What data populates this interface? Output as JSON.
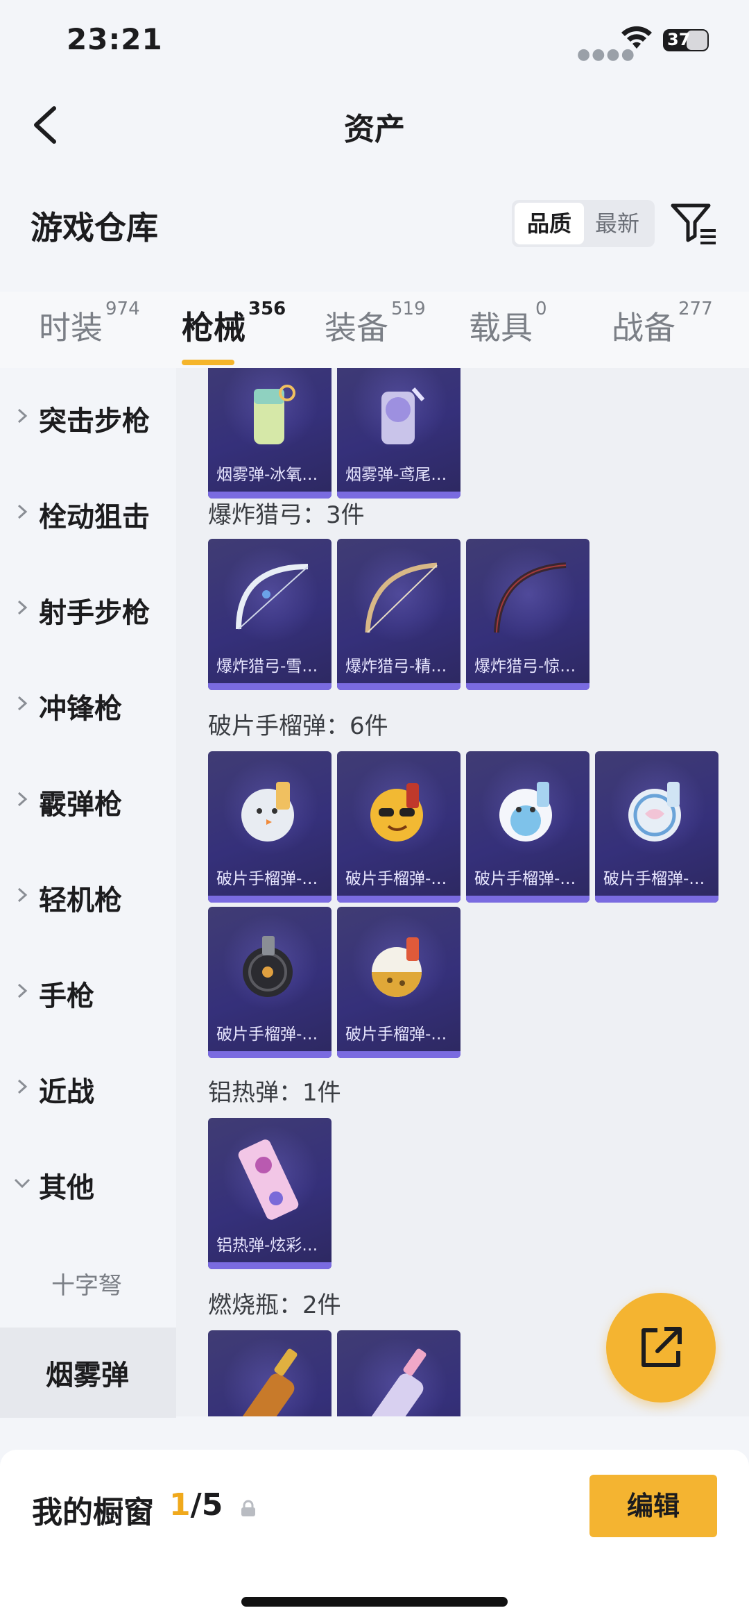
{
  "status": {
    "time": "23:21",
    "battery": "37"
  },
  "nav": {
    "title": "资产"
  },
  "warehouse": {
    "label": "游戏仓库",
    "sort_options": [
      "品质",
      "最新"
    ],
    "sort_selected": "品质"
  },
  "tabs": [
    {
      "label": "时装",
      "count": "974"
    },
    {
      "label": "枪械",
      "count": "356",
      "active": true
    },
    {
      "label": "装备",
      "count": "519"
    },
    {
      "label": "载具",
      "count": "0"
    },
    {
      "label": "战备",
      "count": "277"
    }
  ],
  "sidebar": {
    "items": [
      "突击步枪",
      "栓动狙击",
      "射手步枪",
      "冲锋枪",
      "霰弹枪",
      "轻机枪",
      "手枪",
      "近战",
      "其他"
    ],
    "sub_item": "十字弩",
    "selected": "烟雾弹"
  },
  "content": {
    "smoke_cards": [
      "烟雾弹-冰氧…",
      "烟雾弹-鸢尾…"
    ],
    "sections": [
      {
        "title": "爆炸猎弓：3件",
        "cards": [
          "爆炸猎弓-雪…",
          "爆炸猎弓-精…",
          "爆炸猎弓-惊…"
        ]
      },
      {
        "title": "破片手榴弹：6件",
        "cards": [
          "破片手榴弹-…",
          "破片手榴弹-…",
          "破片手榴弹-…",
          "破片手榴弹-…",
          "破片手榴弹-…",
          "破片手榴弹-…"
        ]
      },
      {
        "title": "铝热弹：1件",
        "cards": [
          "铝热弹-炫彩…"
        ]
      },
      {
        "title": "燃烧瓶：2件",
        "cards": [
          "",
          ""
        ]
      }
    ]
  },
  "showcase": {
    "label": "我的橱窗",
    "current": "1",
    "total": "/5",
    "edit_label": "编辑"
  },
  "colors": {
    "accent": "#f4b431",
    "card": "#35307a",
    "card_bar": "#7a6be0"
  }
}
